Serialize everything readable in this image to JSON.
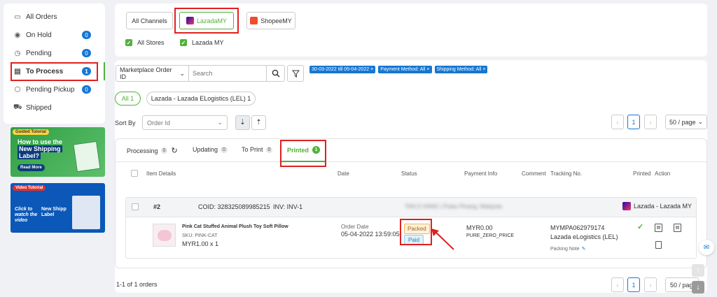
{
  "sidebar": {
    "items": [
      {
        "label": "All Orders",
        "icon": "inbox-icon",
        "count": ""
      },
      {
        "label": "On Hold",
        "icon": "pause-icon",
        "count": "0"
      },
      {
        "label": "Pending",
        "icon": "clock-icon",
        "count": "0"
      },
      {
        "label": "To Process",
        "icon": "document-icon",
        "count": "1"
      },
      {
        "label": "Pending Pickup",
        "icon": "box-icon",
        "count": "0"
      },
      {
        "label": "Shipped",
        "icon": "truck-icon",
        "count": ""
      }
    ],
    "banner1": {
      "tag": "Guided Tutorial",
      "line1": "How to use the",
      "line2": "New Shipping",
      "line3": "Label?",
      "cta": "Read More"
    },
    "banner2": {
      "tag": "Video Tutorial",
      "line1": "Click to",
      "line2": "watch the",
      "line3": "video",
      "title1": "New Shipp",
      "title2": "Label"
    }
  },
  "channels": {
    "all": "All Channels",
    "lazada": "LazadaMY",
    "shopee": "ShopeeMY",
    "all_stores": "All Stores",
    "lazada_store": "Lazada MY"
  },
  "search": {
    "field_select": "Marketplace Order ID",
    "placeholder": "Search"
  },
  "filters": {
    "tags": [
      "30-03-2022 till 05-04-2022",
      "Payment Method: All",
      "Shipping Method: All"
    ]
  },
  "pills": {
    "all": "All 1",
    "lel": "Lazada - Lazada ELogistics (LEL) 1"
  },
  "sort": {
    "label": "Sort By",
    "value": "Order Id"
  },
  "pagination": {
    "page": "1",
    "per_page": "50 / page",
    "summary": "1-1 of 1 orders"
  },
  "tabs": [
    {
      "label": "Processing",
      "count": "0"
    },
    {
      "label": "Updating",
      "count": "0"
    },
    {
      "label": "To Print",
      "count": "0"
    },
    {
      "label": "Printed",
      "count": "1"
    }
  ],
  "table": {
    "headers": [
      "Item Details",
      "Date",
      "Status",
      "Payment Info",
      "Comment",
      "Tracking No.",
      "Printed",
      "Action"
    ]
  },
  "order": {
    "number": "#2",
    "coid": "COID: 328325089985215",
    "inv": "INV: INV-1",
    "address_blurred": "TAN D HANG | Pulau Pinang, Malaysia",
    "channel": "Lazada - Lazada MY",
    "product_name": "Pink Cat Stuffed Animal Plush Toy Soft Pillow",
    "sku": "SKU: PINK-CAT",
    "price_qty": "MYR1.00 x 1",
    "date_label": "Order Date",
    "date_value": "05-04-2022 13:59:05",
    "status1": "Packed",
    "status2": "Paid",
    "payment_amount": "MYR0.00",
    "payment_method": "PURE_ZERO_PRICE",
    "tracking_no": "MYMPA062979174",
    "courier": "Lazada eLogistics (LEL)",
    "packing_note": "Packing Note"
  },
  "colors": {
    "accent": "#1677d2",
    "green": "#52b13a",
    "annotation_red": "#e0201f"
  }
}
